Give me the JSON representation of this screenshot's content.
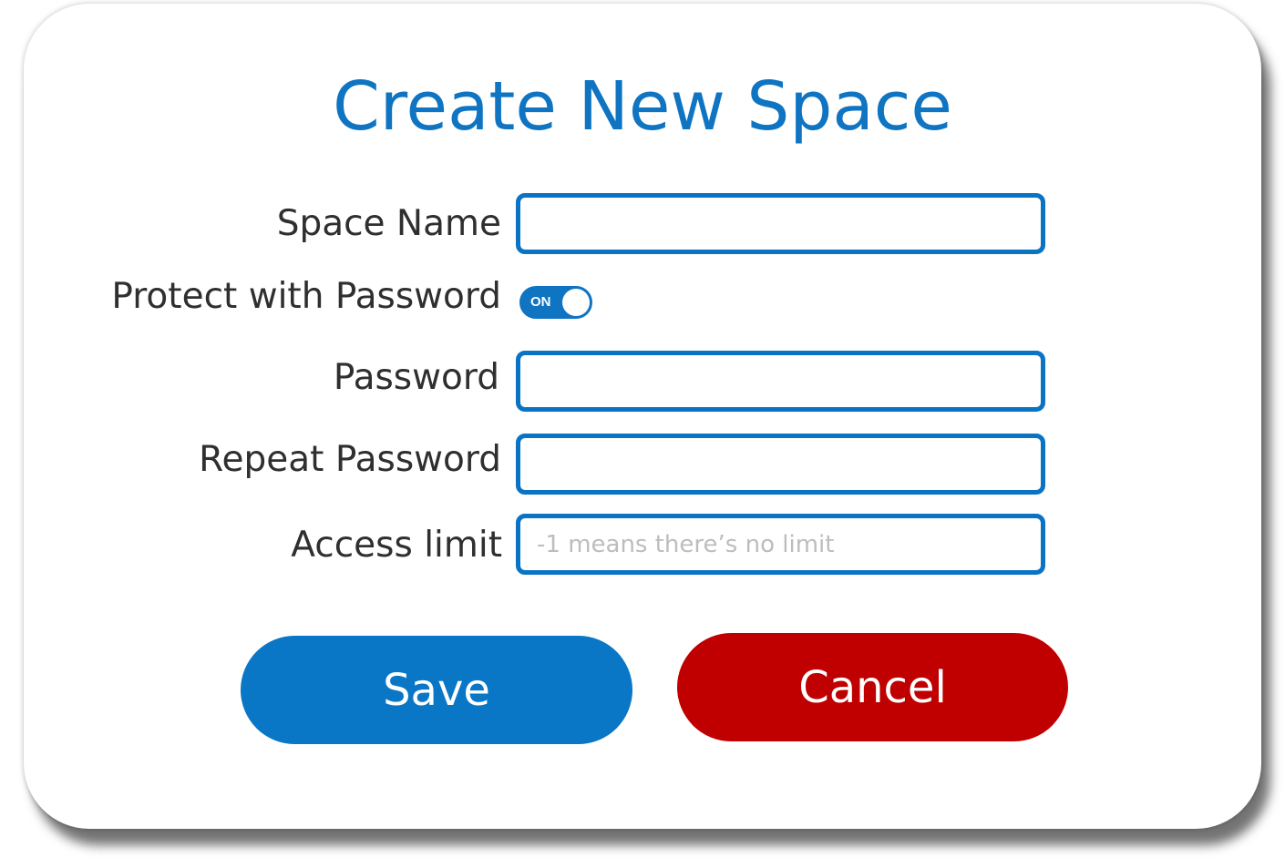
{
  "dialog": {
    "title": "Create New Space"
  },
  "form": {
    "space_name": {
      "label": "Space Name",
      "value": "",
      "placeholder": ""
    },
    "protect_with_password": {
      "label": "Protect with Password",
      "toggle_text": "ON",
      "enabled": true
    },
    "password": {
      "label": "Password",
      "value": "",
      "placeholder": ""
    },
    "repeat_password": {
      "label": "Repeat Password",
      "value": "",
      "placeholder": ""
    },
    "access_limit": {
      "label": "Access limit",
      "value": "",
      "placeholder": "-1 means there’s no limit"
    }
  },
  "buttons": {
    "save_label": "Save",
    "cancel_label": "Cancel"
  },
  "colors": {
    "accent": "#0f74c2",
    "danger": "#c00000",
    "label_text": "#2f2f2f",
    "placeholder_text": "#bdbdbd"
  }
}
